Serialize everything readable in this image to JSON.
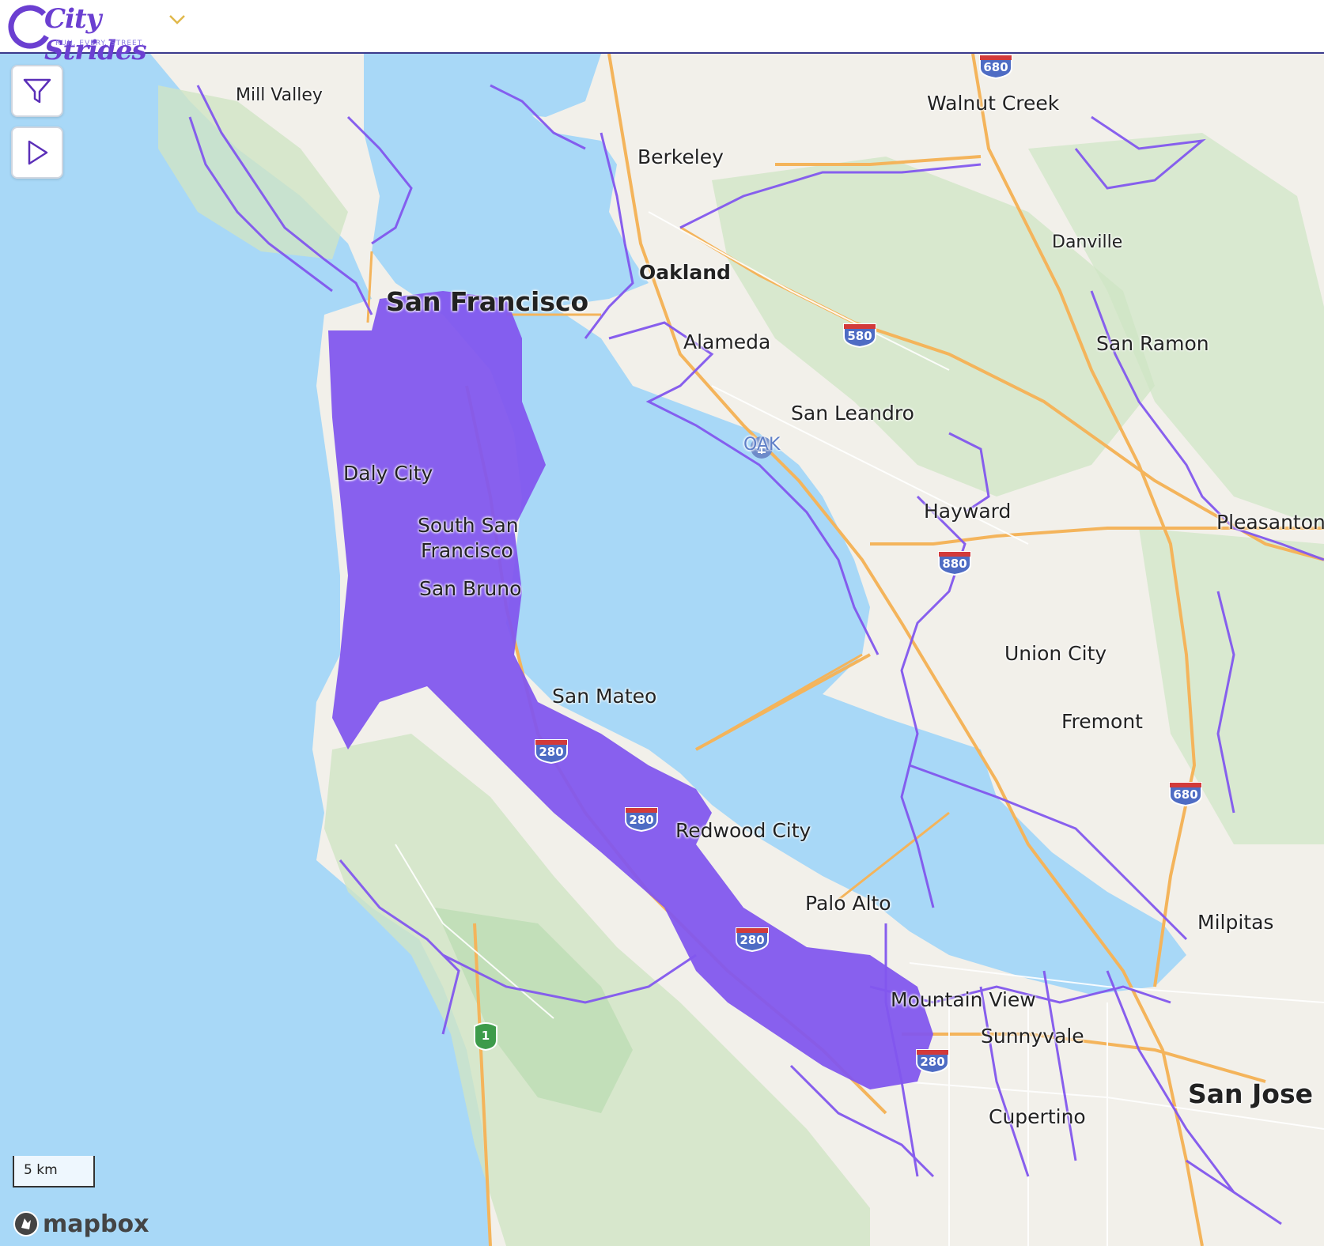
{
  "header": {
    "logo_title": "City Strides",
    "logo_tagline": "RUN. EVERY. STREET."
  },
  "controls": {
    "filter_icon": "filter-icon",
    "play_icon": "play-icon"
  },
  "places": {
    "mill_valley": "Mill Valley",
    "walnut_creek": "Walnut Creek",
    "berkeley": "Berkeley",
    "danville": "Danville",
    "oakland": "Oakland",
    "san_francisco": "San Francisco",
    "alameda": "Alameda",
    "san_ramon": "San Ramon",
    "san_leandro": "San Leandro",
    "oak": "OAK",
    "daly_city": "Daly City",
    "hayward": "Hayward",
    "pleasanton": "Pleasanton",
    "south_sf_1": "South San",
    "south_sf_2": "Francisco",
    "san_bruno": "San Bruno",
    "union_city": "Union City",
    "san_mateo": "San Mateo",
    "fremont": "Fremont",
    "redwood_city": "Redwood City",
    "palo_alto": "Palo Alto",
    "milpitas": "Milpitas",
    "mountain_view": "Mountain View",
    "sunnyvale": "Sunnyvale",
    "cupertino": "Cupertino",
    "san_jose": "San Jose"
  },
  "highways": {
    "i680_top": "680",
    "i580": "580",
    "i880": "880",
    "i280_a": "280",
    "i280_b": "280",
    "i280_c": "280",
    "i680_bottom": "680",
    "i280_d": "280",
    "ca1": "1"
  },
  "scale_label": "5 km",
  "attribution": "mapbox",
  "colors": {
    "brand": "#6b3fd1",
    "route": "#8257ee",
    "water": "#a8d8f7",
    "land": "#f2f0ea",
    "park": "#cfe5c4",
    "interstate": "#4e6cc4"
  }
}
